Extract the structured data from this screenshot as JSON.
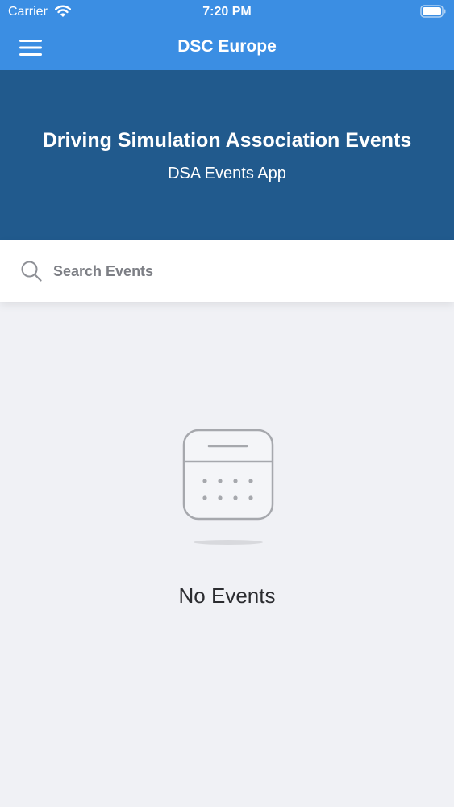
{
  "status_bar": {
    "carrier": "Carrier",
    "time": "7:20 PM",
    "wifi_icon": "wifi-icon",
    "battery_icon": "battery-icon"
  },
  "nav_bar": {
    "title": "DSC Europe",
    "menu_icon": "hamburger-menu-icon",
    "background_color": "#3b8ee3"
  },
  "banner": {
    "title": "Driving Simulation Association Events",
    "subtitle": "DSA Events App",
    "background_color": "#215a8d"
  },
  "search": {
    "placeholder": "Search Events",
    "value": "",
    "icon": "search-icon"
  },
  "empty_state": {
    "icon": "calendar-icon",
    "message": "No Events"
  }
}
